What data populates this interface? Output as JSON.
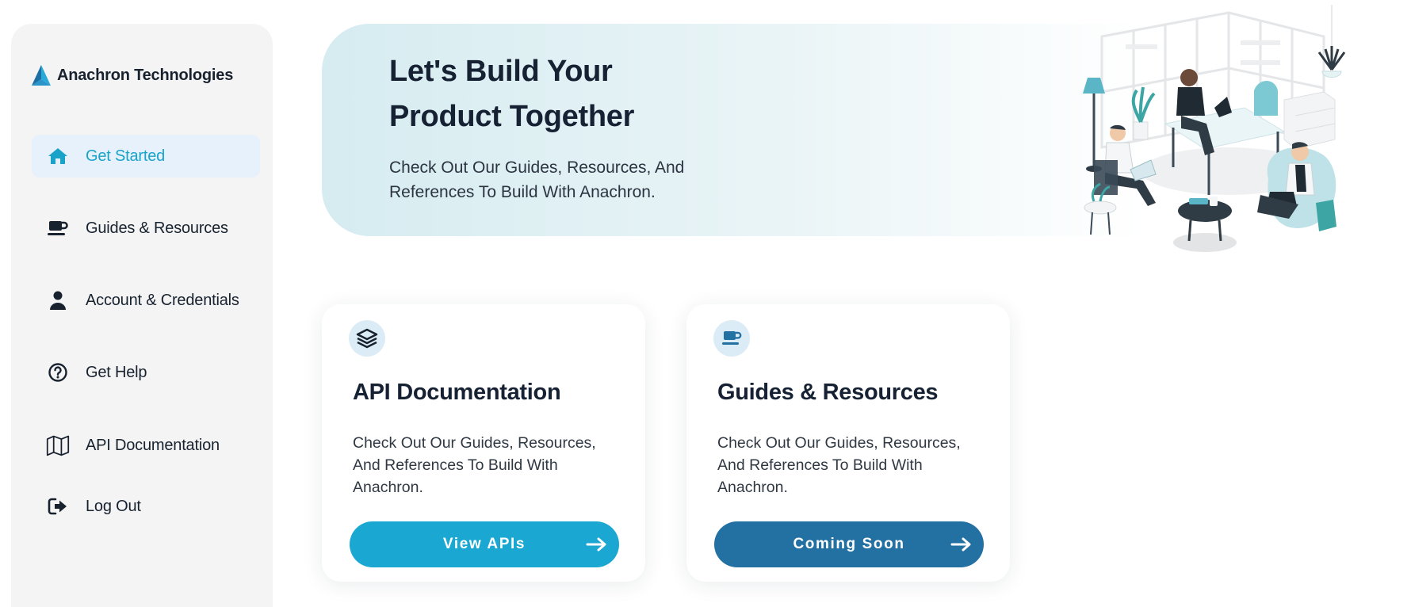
{
  "brand": {
    "name": "Anachron Technologies",
    "logo_icon": "triangle-logo",
    "logo_colors": [
      "#29a9d8",
      "#1b6fa4"
    ]
  },
  "sidebar": {
    "items": [
      {
        "label": "Get Started",
        "icon": "home-icon",
        "active": true
      },
      {
        "label": "Guides & Resources",
        "icon": "coffee-cup-icon",
        "active": false
      },
      {
        "label": "Account & Credentials",
        "icon": "user-icon",
        "active": false
      },
      {
        "label": "Get Help",
        "icon": "question-circle-icon",
        "active": false
      },
      {
        "label": "API Documentation",
        "icon": "map-icon",
        "active": false
      },
      {
        "label": "Log Out",
        "icon": "logout-icon",
        "active": false
      }
    ]
  },
  "hero": {
    "title": "Let's Build Your Product Together",
    "subtitle": "Check Out Our Guides, Resources, And References To Build With Anachron.",
    "illustration": "coworking-office-illustration"
  },
  "cards": [
    {
      "icon": "layers-icon",
      "title": "API Documentation",
      "description": "Check Out Our Guides, Resources, And References To Build With Anachron.",
      "button_label": "View APIs",
      "button_color": "#1aa7d2"
    },
    {
      "icon": "coffee-cup-icon",
      "title": "Guides & Resources",
      "description": "Check Out Our Guides, Resources, And References To Build With Anachron.",
      "button_label": "Coming Soon",
      "button_color": "#2370a3"
    }
  ],
  "colors": {
    "accent": "#1aa3c8",
    "active_bg": "#e6f1fb",
    "text_dark": "#18222f",
    "sidebar_bg": "#f4f4f5"
  }
}
